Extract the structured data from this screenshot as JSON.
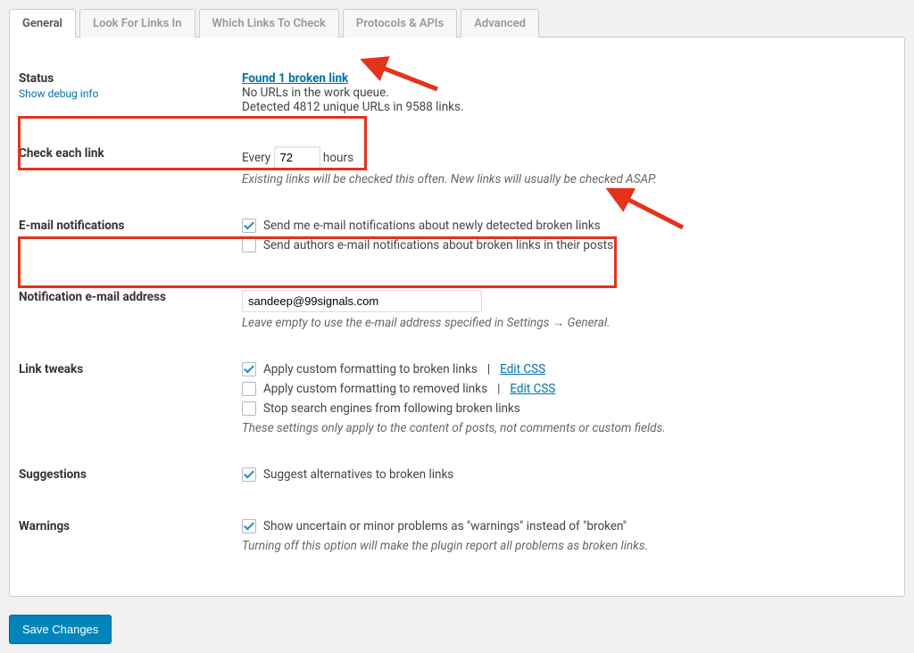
{
  "tabs": {
    "general": "General",
    "look_for": "Look For Links In",
    "which": "Which Links To Check",
    "protocols": "Protocols & APIs",
    "advanced": "Advanced"
  },
  "rows": {
    "status": {
      "label": "Status",
      "debug": "Show debug info",
      "broken": "Found 1 broken link",
      "line1": "No URLs in the work queue.",
      "line2": "Detected 4812 unique URLs in 9588 links."
    },
    "check": {
      "label": "Check each link",
      "prefix": "Every",
      "value": "72",
      "suffix": "hours",
      "desc": "Existing links will be checked this often. New links will usually be checked ASAP."
    },
    "email": {
      "label": "E-mail notifications",
      "cb1": "Send me e-mail notifications about newly detected broken links",
      "cb2": "Send authors e-mail notifications about broken links in their posts"
    },
    "notif_addr": {
      "label": "Notification e-mail address",
      "value": "sandeep@99signals.com",
      "desc": "Leave empty to use the e-mail address specified in Settings → General."
    },
    "tweaks": {
      "label": "Link tweaks",
      "cb1": "Apply custom formatting to broken links",
      "cb2": "Apply custom formatting to removed links",
      "cb3": "Stop search engines from following broken links",
      "edit_css": "Edit CSS",
      "desc": "These settings only apply to the content of posts, not comments or custom fields."
    },
    "suggestions": {
      "label": "Suggestions",
      "cb1": "Suggest alternatives to broken links"
    },
    "warnings": {
      "label": "Warnings",
      "cb1": "Show uncertain or minor problems as \"warnings\" instead of \"broken\"",
      "desc": "Turning off this option will make the plugin report all problems as broken links."
    }
  },
  "save": "Save Changes"
}
